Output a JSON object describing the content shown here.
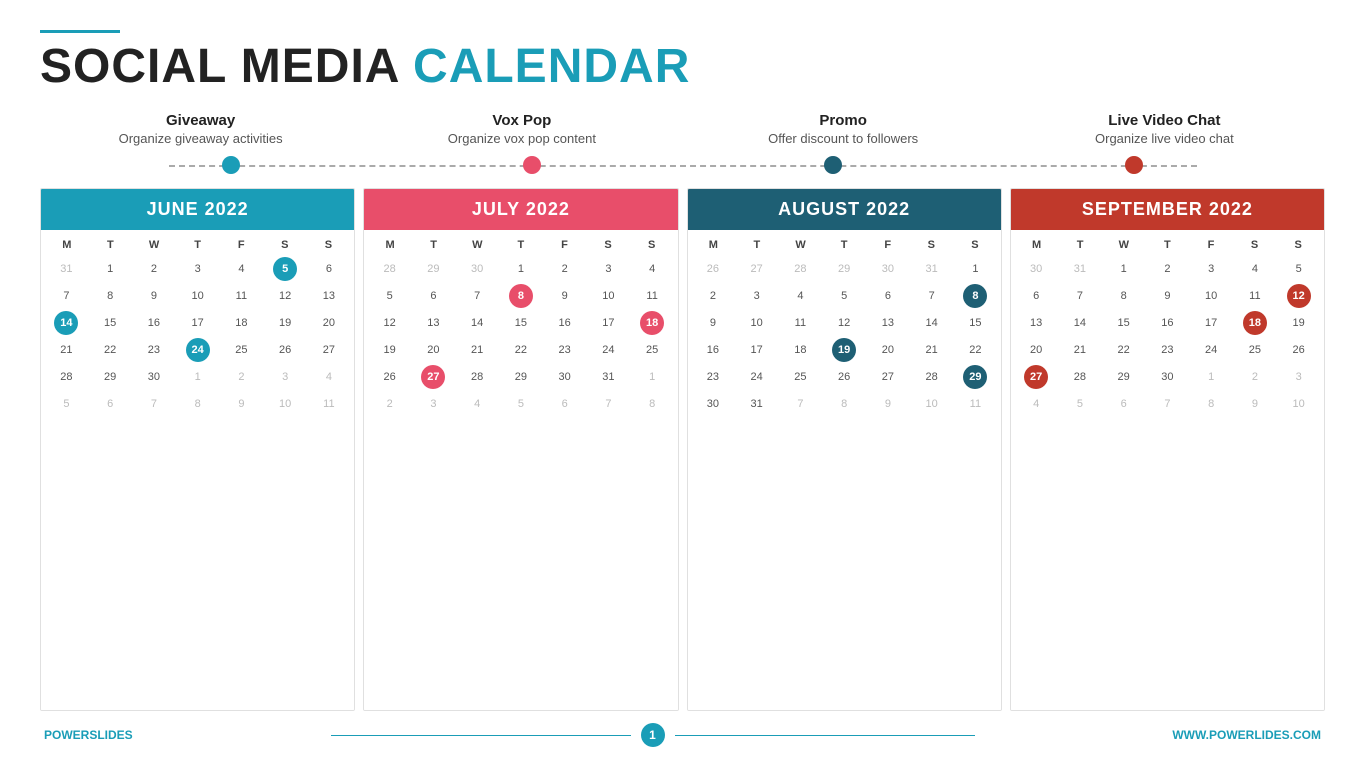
{
  "header": {
    "line_color": "#1a9db7",
    "title_black": "SOCIAL MEDIA",
    "title_blue": "CALENDAR"
  },
  "categories": [
    {
      "title": "Giveaway",
      "desc": "Organize giveaway activities"
    },
    {
      "title": "Vox Pop",
      "desc": "Organize vox pop content"
    },
    {
      "title": "Promo",
      "desc": "Offer discount to followers"
    },
    {
      "title": "Live Video Chat",
      "desc": "Organize live video chat"
    }
  ],
  "timeline": {
    "dots": [
      "blue",
      "pink",
      "darkblue",
      "darkred"
    ]
  },
  "calendars": [
    {
      "title": "JUNE 2022",
      "style": "blue-bg",
      "days": [
        "M",
        "T",
        "W",
        "T",
        "F",
        "S",
        "S"
      ],
      "cells": [
        {
          "n": "31",
          "type": "other"
        },
        {
          "n": "1"
        },
        {
          "n": "2"
        },
        {
          "n": "3"
        },
        {
          "n": "4"
        },
        {
          "n": "5",
          "hl": "blue"
        },
        {
          "n": "6"
        },
        {
          "n": "7"
        },
        {
          "n": "8"
        },
        {
          "n": "9"
        },
        {
          "n": "10"
        },
        {
          "n": "11"
        },
        {
          "n": "12"
        },
        {
          "n": "13"
        },
        {
          "n": "14",
          "hl": "blue"
        },
        {
          "n": "15"
        },
        {
          "n": "16"
        },
        {
          "n": "17"
        },
        {
          "n": "18"
        },
        {
          "n": "19"
        },
        {
          "n": "20"
        },
        {
          "n": "21"
        },
        {
          "n": "22"
        },
        {
          "n": "23"
        },
        {
          "n": "24",
          "hl": "blue"
        },
        {
          "n": "25"
        },
        {
          "n": "26"
        },
        {
          "n": "27"
        },
        {
          "n": "28"
        },
        {
          "n": "29"
        },
        {
          "n": "30"
        },
        {
          "n": "1",
          "type": "other"
        },
        {
          "n": "2",
          "type": "other"
        },
        {
          "n": "3",
          "type": "other"
        },
        {
          "n": "4",
          "type": "other"
        },
        {
          "n": "5",
          "type": "other"
        },
        {
          "n": "6",
          "type": "other"
        },
        {
          "n": "7",
          "type": "other"
        },
        {
          "n": "8",
          "type": "other"
        },
        {
          "n": "9",
          "type": "other"
        },
        {
          "n": "10",
          "type": "other"
        },
        {
          "n": "11",
          "type": "other"
        }
      ]
    },
    {
      "title": "JULY 2022",
      "style": "pink-bg",
      "days": [
        "M",
        "T",
        "W",
        "T",
        "F",
        "S",
        "S"
      ],
      "cells": [
        {
          "n": "28",
          "type": "other"
        },
        {
          "n": "29",
          "type": "other"
        },
        {
          "n": "30",
          "type": "other"
        },
        {
          "n": "1"
        },
        {
          "n": "2"
        },
        {
          "n": "3"
        },
        {
          "n": "4"
        },
        {
          "n": "5"
        },
        {
          "n": "6"
        },
        {
          "n": "7"
        },
        {
          "n": "8",
          "hl": "pink"
        },
        {
          "n": "9"
        },
        {
          "n": "10"
        },
        {
          "n": "11"
        },
        {
          "n": "12"
        },
        {
          "n": "13"
        },
        {
          "n": "14"
        },
        {
          "n": "15"
        },
        {
          "n": "16"
        },
        {
          "n": "17"
        },
        {
          "n": "18",
          "hl": "pink"
        },
        {
          "n": "19"
        },
        {
          "n": "20"
        },
        {
          "n": "21"
        },
        {
          "n": "22"
        },
        {
          "n": "23"
        },
        {
          "n": "24"
        },
        {
          "n": "25"
        },
        {
          "n": "26"
        },
        {
          "n": "27",
          "hl": "pink"
        },
        {
          "n": "28"
        },
        {
          "n": "29"
        },
        {
          "n": "30"
        },
        {
          "n": "31"
        },
        {
          "n": "1",
          "type": "other"
        },
        {
          "n": "2",
          "type": "other"
        },
        {
          "n": "3",
          "type": "other"
        },
        {
          "n": "4",
          "type": "other"
        },
        {
          "n": "5",
          "type": "other"
        },
        {
          "n": "6",
          "type": "other"
        },
        {
          "n": "7",
          "type": "other"
        },
        {
          "n": "8",
          "type": "other"
        }
      ]
    },
    {
      "title": "AUGUST 2022",
      "style": "darkblue-bg",
      "days": [
        "M",
        "T",
        "W",
        "T",
        "F",
        "S",
        "S"
      ],
      "cells": [
        {
          "n": "26",
          "type": "other"
        },
        {
          "n": "27",
          "type": "other"
        },
        {
          "n": "28",
          "type": "other"
        },
        {
          "n": "29",
          "type": "other"
        },
        {
          "n": "30",
          "type": "other"
        },
        {
          "n": "31",
          "type": "other"
        },
        {
          "n": "1"
        },
        {
          "n": "2"
        },
        {
          "n": "3"
        },
        {
          "n": "4"
        },
        {
          "n": "5"
        },
        {
          "n": "6"
        },
        {
          "n": "7"
        },
        {
          "n": "8",
          "hl": "darkblue"
        },
        {
          "n": "9"
        },
        {
          "n": "10"
        },
        {
          "n": "11"
        },
        {
          "n": "12"
        },
        {
          "n": "13"
        },
        {
          "n": "14"
        },
        {
          "n": "15"
        },
        {
          "n": "16"
        },
        {
          "n": "17"
        },
        {
          "n": "18"
        },
        {
          "n": "19",
          "hl": "darkblue"
        },
        {
          "n": "20"
        },
        {
          "n": "21"
        },
        {
          "n": "22"
        },
        {
          "n": "23"
        },
        {
          "n": "24"
        },
        {
          "n": "25"
        },
        {
          "n": "26"
        },
        {
          "n": "27"
        },
        {
          "n": "28"
        },
        {
          "n": "29",
          "hl": "darkblue"
        },
        {
          "n": "30"
        },
        {
          "n": "31"
        },
        {
          "n": "7",
          "type": "other"
        },
        {
          "n": "8",
          "type": "other"
        },
        {
          "n": "9",
          "type": "other"
        },
        {
          "n": "10",
          "type": "other"
        },
        {
          "n": "11",
          "type": "other"
        }
      ]
    },
    {
      "title": "SEPTEMBER 2022",
      "style": "darkred-bg",
      "days": [
        "M",
        "T",
        "W",
        "T",
        "F",
        "S",
        "S"
      ],
      "cells": [
        {
          "n": "30",
          "type": "other"
        },
        {
          "n": "31",
          "type": "other"
        },
        {
          "n": "1"
        },
        {
          "n": "2"
        },
        {
          "n": "3"
        },
        {
          "n": "4"
        },
        {
          "n": "5"
        },
        {
          "n": "6"
        },
        {
          "n": "7"
        },
        {
          "n": "8"
        },
        {
          "n": "9"
        },
        {
          "n": "10"
        },
        {
          "n": "11"
        },
        {
          "n": "12",
          "hl": "darkred"
        },
        {
          "n": "13"
        },
        {
          "n": "14"
        },
        {
          "n": "15"
        },
        {
          "n": "16"
        },
        {
          "n": "17"
        },
        {
          "n": "18",
          "hl": "darkred"
        },
        {
          "n": "19"
        },
        {
          "n": "20"
        },
        {
          "n": "21"
        },
        {
          "n": "22"
        },
        {
          "n": "23"
        },
        {
          "n": "24"
        },
        {
          "n": "25"
        },
        {
          "n": "26"
        },
        {
          "n": "27",
          "hl": "darkred"
        },
        {
          "n": "28"
        },
        {
          "n": "29"
        },
        {
          "n": "30"
        },
        {
          "n": "1",
          "type": "other"
        },
        {
          "n": "2",
          "type": "other"
        },
        {
          "n": "3",
          "type": "other"
        },
        {
          "n": "4",
          "type": "other"
        },
        {
          "n": "5",
          "type": "other"
        },
        {
          "n": "6",
          "type": "other"
        },
        {
          "n": "7",
          "type": "other"
        },
        {
          "n": "8",
          "type": "other"
        },
        {
          "n": "9",
          "type": "other"
        },
        {
          "n": "10",
          "type": "other"
        }
      ]
    }
  ],
  "footer": {
    "brand_black": "POWER",
    "brand_blue": "SLIDES",
    "page_number": "1",
    "website": "WWW.POWERLIDES.COM"
  }
}
